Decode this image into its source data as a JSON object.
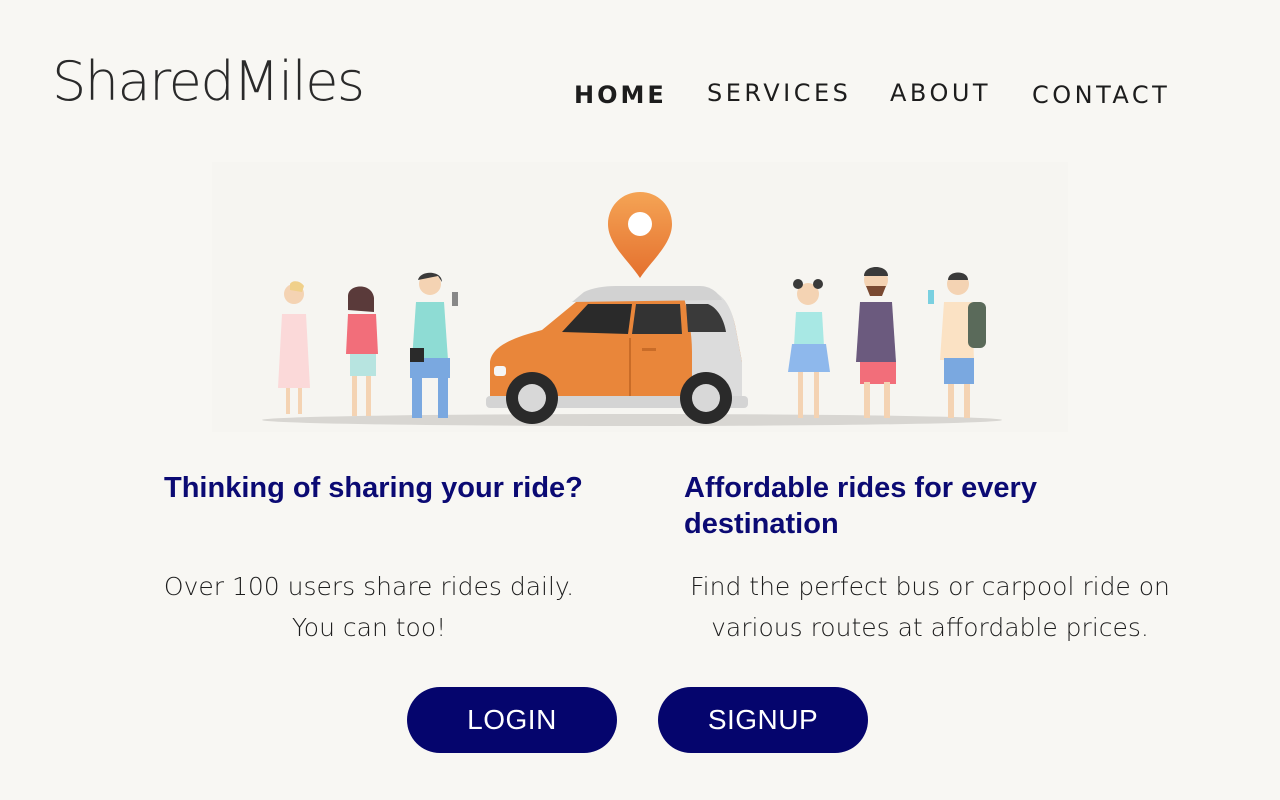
{
  "brand": {
    "name": "SharedMiles"
  },
  "nav": {
    "items": [
      {
        "label": "HOME",
        "active": true
      },
      {
        "label": "SERVICES",
        "active": false
      },
      {
        "label": "ABOUT",
        "active": false
      },
      {
        "label": "CONTACT",
        "active": false
      }
    ]
  },
  "hero": {
    "illustration": "people-around-car-with-location-pin"
  },
  "columns": [
    {
      "title": "Thinking of sharing your ride?",
      "text": "Over 100 users share rides daily. You can too!"
    },
    {
      "title": "Affordable rides for every destination",
      "text": "Find the perfect bus or carpool ride on various routes at affordable prices."
    }
  ],
  "actions": {
    "login_label": "LOGIN",
    "signup_label": "SIGNUP"
  },
  "colors": {
    "accent": "#05056d",
    "heading": "#0b0a73",
    "background": "#f8f7f3",
    "car": "#e9863a",
    "pin": "#f08a3c"
  }
}
